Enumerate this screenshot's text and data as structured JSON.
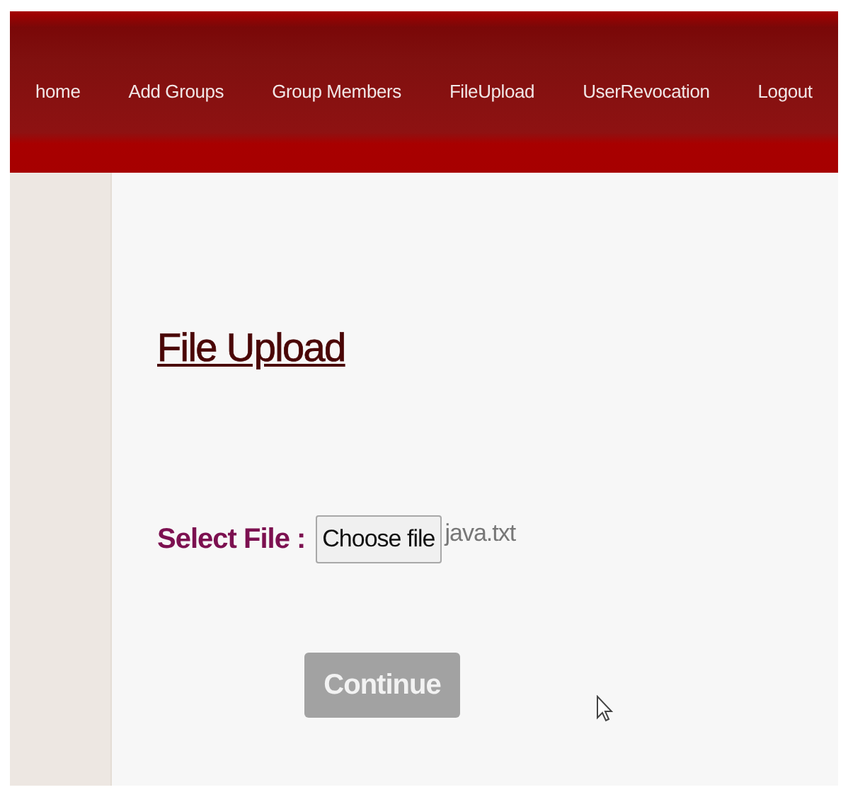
{
  "nav": {
    "items": [
      {
        "label": "home"
      },
      {
        "label": "Add Groups"
      },
      {
        "label": "Group Members"
      },
      {
        "label": "FileUpload"
      },
      {
        "label": "UserRevocation"
      },
      {
        "label": "Logout"
      }
    ]
  },
  "upload": {
    "title": "File Upload",
    "field_label": "Select File :",
    "choose_button": "Choose file",
    "file_name": "java.txt",
    "continue_button": {
      "label": "Continue",
      "disabled": true
    }
  }
}
